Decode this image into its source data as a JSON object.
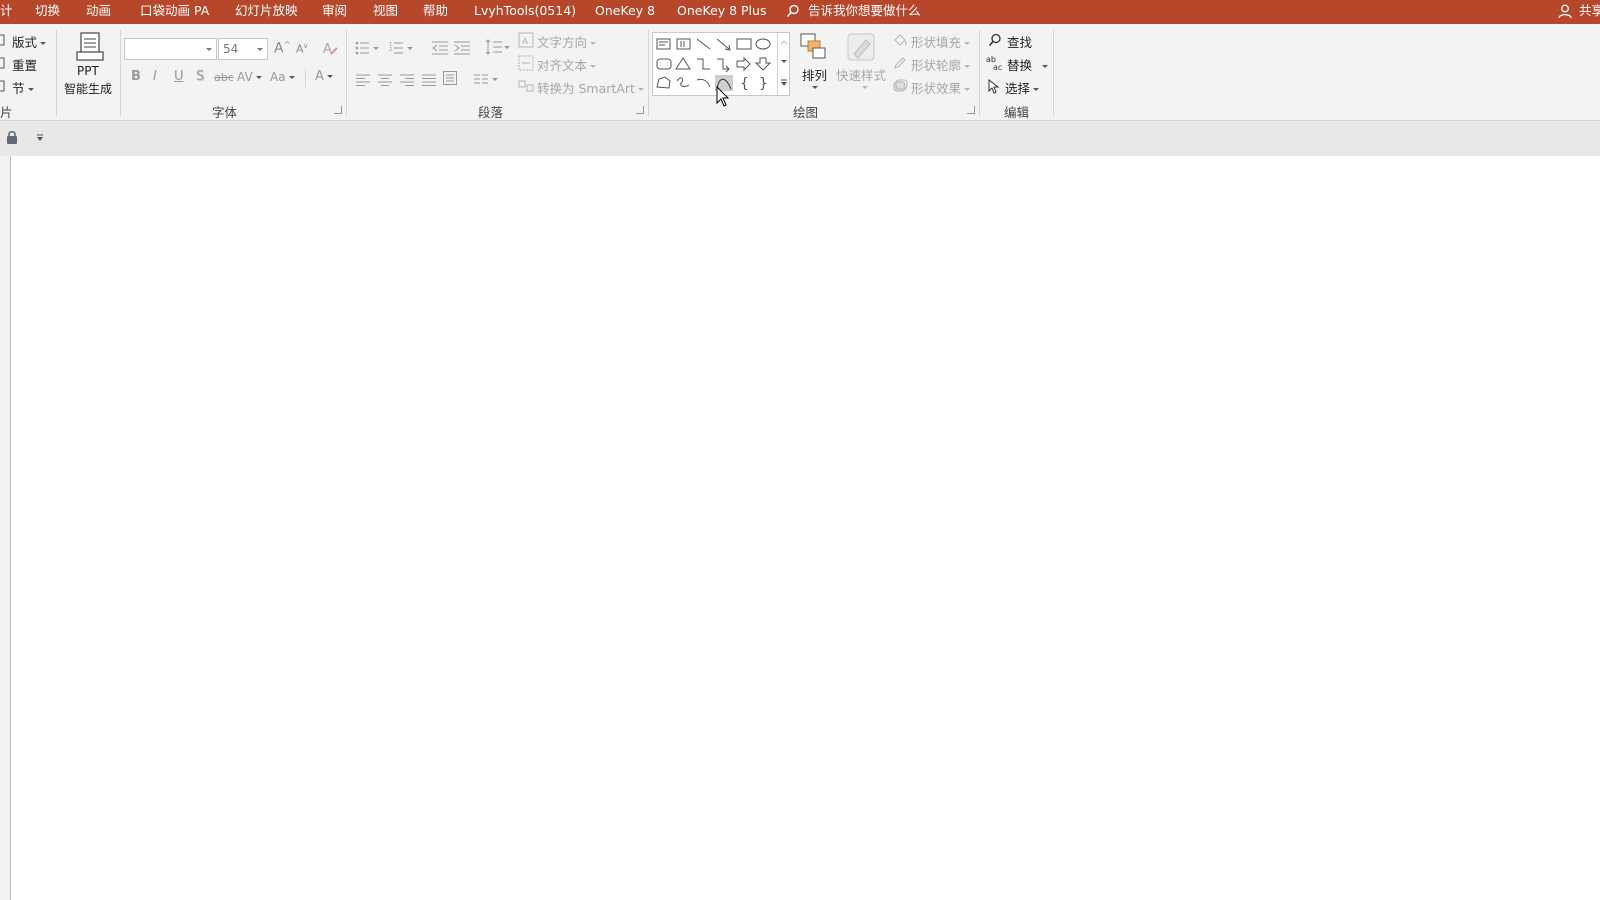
{
  "tabs": [
    {
      "label": "计"
    },
    {
      "label": "切换"
    },
    {
      "label": "动画"
    },
    {
      "label": "口袋动画 PA"
    },
    {
      "label": "幻灯片放映"
    },
    {
      "label": "审阅"
    },
    {
      "label": "视图"
    },
    {
      "label": "帮助"
    },
    {
      "label": "LvyhTools(0514)"
    },
    {
      "label": "OneKey 8"
    },
    {
      "label": "OneKey 8 Plus"
    }
  ],
  "tell_me": "告诉我你想要做什么",
  "share": "共享",
  "slides_group": {
    "layout": "版式",
    "reset": "重置",
    "section": "节",
    "label": "片"
  },
  "ppt_ai": {
    "line1": "PPT",
    "line2": "智能生成"
  },
  "font_group": {
    "font_name": "",
    "font_size": "54",
    "grow": "A",
    "shrink": "A",
    "bold": "B",
    "italic": "I",
    "underline": "U",
    "shadow": "S",
    "strike": "abc",
    "spacing": "AV",
    "case": "Aa",
    "color": "A",
    "label": "字体"
  },
  "paragraph_group": {
    "text_direction": "文字方向",
    "align_text": "对齐文本",
    "convert_smartart": "转换为 SmartArt",
    "label": "段落"
  },
  "drawing_group": {
    "arrange": "排列",
    "quick_styles": "快速样式",
    "shape_fill": "形状填充",
    "shape_outline": "形状轮廓",
    "shape_effects": "形状效果",
    "label": "绘图"
  },
  "editing_group": {
    "find": "查找",
    "replace": "替换",
    "select": "选择",
    "label": "编辑"
  },
  "colors": {
    "tabbar": "#b7472a",
    "ribbon": "#f3f3f3",
    "canvas": "#ffffff"
  }
}
